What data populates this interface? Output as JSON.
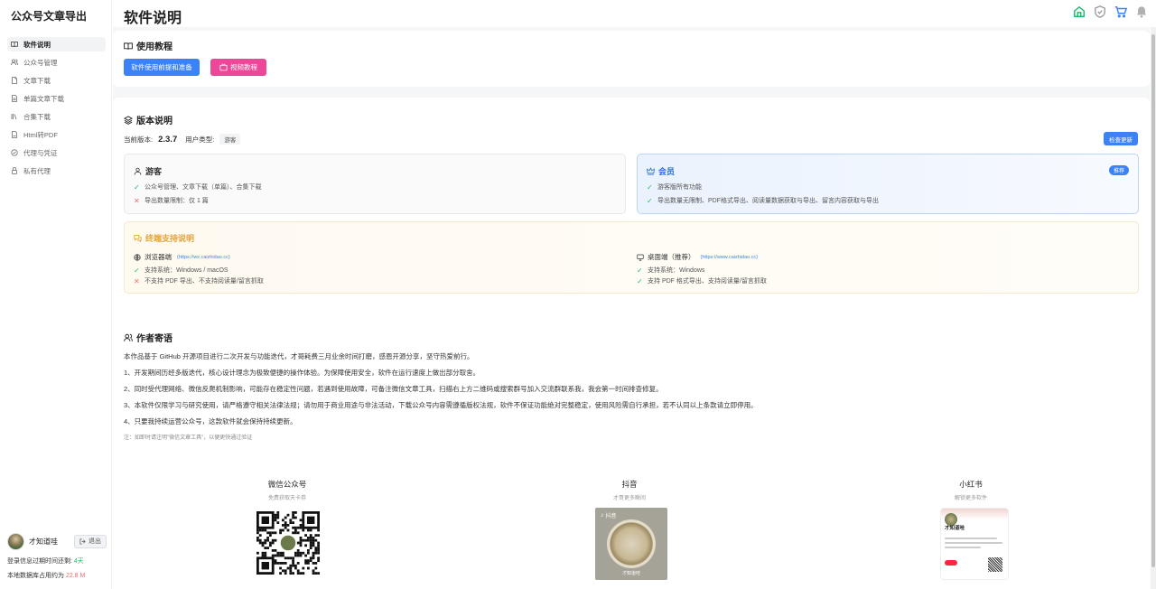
{
  "sidebar": {
    "app_title": "公众号文章导出",
    "items": [
      {
        "label": "软件说明",
        "icon": "book-icon",
        "active": true
      },
      {
        "label": "公众号管理",
        "icon": "users-icon"
      },
      {
        "label": "文章下载",
        "icon": "file-icon"
      },
      {
        "label": "单篇文章下载",
        "icon": "file-text-icon"
      },
      {
        "label": "合集下载",
        "icon": "library-icon"
      },
      {
        "label": "Html转PDF",
        "icon": "file-pdf-icon"
      },
      {
        "label": "代理与凭证",
        "icon": "shield-icon"
      },
      {
        "label": "私有代理",
        "icon": "lock-icon"
      }
    ],
    "user": {
      "name": "才知道哇",
      "logout_label": "退出"
    },
    "login_expire_label": "登录信息过期时间还剩: ",
    "login_expire_value": "4天",
    "storage_label": "本地数据库占用约为 ",
    "storage_value": "22.8 M"
  },
  "header": {
    "title": "软件说明",
    "icons": [
      "home-icon",
      "shield-check-icon",
      "cart-icon",
      "bell-icon"
    ]
  },
  "tutorial": {
    "title": "使用教程",
    "btn_prepare": "软件使用前提和准备",
    "btn_video": "视频教程",
    "colors": {
      "primary": "#3b82f6",
      "pink": "#ec4899"
    }
  },
  "version": {
    "title": "版本说明",
    "current_label": "当前版本:",
    "current_value": "2.3.7",
    "user_type_label": "用户类型:",
    "user_type_value": "游客",
    "check_update": "检查更新",
    "guest": {
      "title": "游客",
      "features": [
        {
          "ok": true,
          "text": "公众号管理、文章下载（单篇）、合集下载"
        },
        {
          "ok": false,
          "text": "导出数量限制：仅 1 篇"
        }
      ]
    },
    "member": {
      "title": "会员",
      "badge": "推荐",
      "features": [
        {
          "ok": true,
          "text": "游客版所有功能"
        },
        {
          "ok": true,
          "text": "导出数量无限制、PDF格式导出、阅读量数据获取与导出、留言内容获取与导出"
        }
      ]
    },
    "support": {
      "title": "终端支持说明",
      "browser": {
        "name": "浏览器端",
        "link": "(https://wx.caizhidao.cc)",
        "features": [
          {
            "ok": true,
            "text": "支持系统：Windows / macOS"
          },
          {
            "ok": false,
            "text": "不支持 PDF 导出、不支持阅读量/留言抓取"
          }
        ]
      },
      "desktop": {
        "name": "桌面端（推荐）",
        "link": "(https://www.caizhidao.cc)",
        "features": [
          {
            "ok": true,
            "text": "支持系统：Windows"
          },
          {
            "ok": true,
            "text": "支持 PDF 格式导出、支持阅读量/留言抓取"
          }
        ]
      }
    }
  },
  "author": {
    "title": "作者寄语",
    "paragraphs": [
      "本作品基于 GitHub 开源项目进行二次开发与功能迭代，才哥耗费三月业余时间打磨，感恩开源分享，坚守热爱前行。",
      "1、开发期间历经多版迭代，核心设计理念为极致便捷的操作体验。为保障使用安全，软件在运行速度上做出部分取舍。",
      "2、同时受代理网络、微信反爬机制影响，可能存在稳定性问题，若遇到使用故障，可备注微信文章工具，扫描右上方二维码或搜索群号加入交流群联系我，我会第一时间排查修复。",
      "3、本软件仅限学习与研究使用，请严格遵守相关法律法规；请勿用于商业用途与非法活动，下载公众号内容需遵循版权法规，软件不保证功能绝对完整稳定，使用风险需自行承担，若不认同以上条款请立即停用。",
      "4、只要我持续运营公众号，这款软件就会保持持续更新。"
    ],
    "note": "注：如即时请注明\"微信文章工具\"，以便更快通过验证"
  },
  "social": [
    {
      "title": "微信公众号",
      "sub": "免费获取天卡券"
    },
    {
      "title": "抖音",
      "sub": "才哥更多瞬间",
      "badge": "抖音",
      "name": "才知道哇"
    },
    {
      "title": "小红书",
      "sub": "解锁更多软件",
      "name": "才知道哇"
    }
  ]
}
